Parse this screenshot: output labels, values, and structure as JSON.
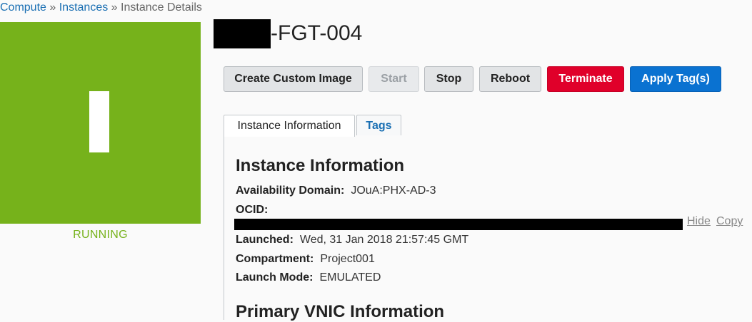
{
  "breadcrumb": {
    "items": [
      "Compute",
      "Instances"
    ],
    "separator": "»",
    "current": "Instance Details"
  },
  "instance": {
    "name_suffix": "-FGT-004",
    "state": "RUNNING",
    "state_color": "#76b21b"
  },
  "actions": [
    {
      "label": "Create Custom Image",
      "variant": "default",
      "enabled": true
    },
    {
      "label": "Start",
      "variant": "disabled",
      "enabled": false
    },
    {
      "label": "Stop",
      "variant": "default",
      "enabled": true
    },
    {
      "label": "Reboot",
      "variant": "default",
      "enabled": true
    },
    {
      "label": "Terminate",
      "variant": "danger",
      "enabled": true,
      "color": "#e0002a"
    },
    {
      "label": "Apply Tag(s)",
      "variant": "primary",
      "enabled": true,
      "color": "#0a72d1"
    }
  ],
  "tabs": [
    {
      "label": "Instance Information",
      "active": true
    },
    {
      "label": "Tags",
      "active": false
    }
  ],
  "info": {
    "heading": "Instance Information",
    "availability_domain": {
      "label": "Availability Domain:",
      "value": "JOuA:PHX-AD-3"
    },
    "ocid": {
      "label": "OCID:",
      "hide_label": "Hide",
      "copy_label": "Copy"
    },
    "launched": {
      "label": "Launched:",
      "value": "Wed, 31 Jan 2018 21:57:45 GMT"
    },
    "compartment": {
      "label": "Compartment:",
      "value": "Project001"
    },
    "launch_mode": {
      "label": "Launch Mode:",
      "value": "EMULATED"
    }
  },
  "vnic": {
    "heading": "Primary VNIC Information"
  }
}
